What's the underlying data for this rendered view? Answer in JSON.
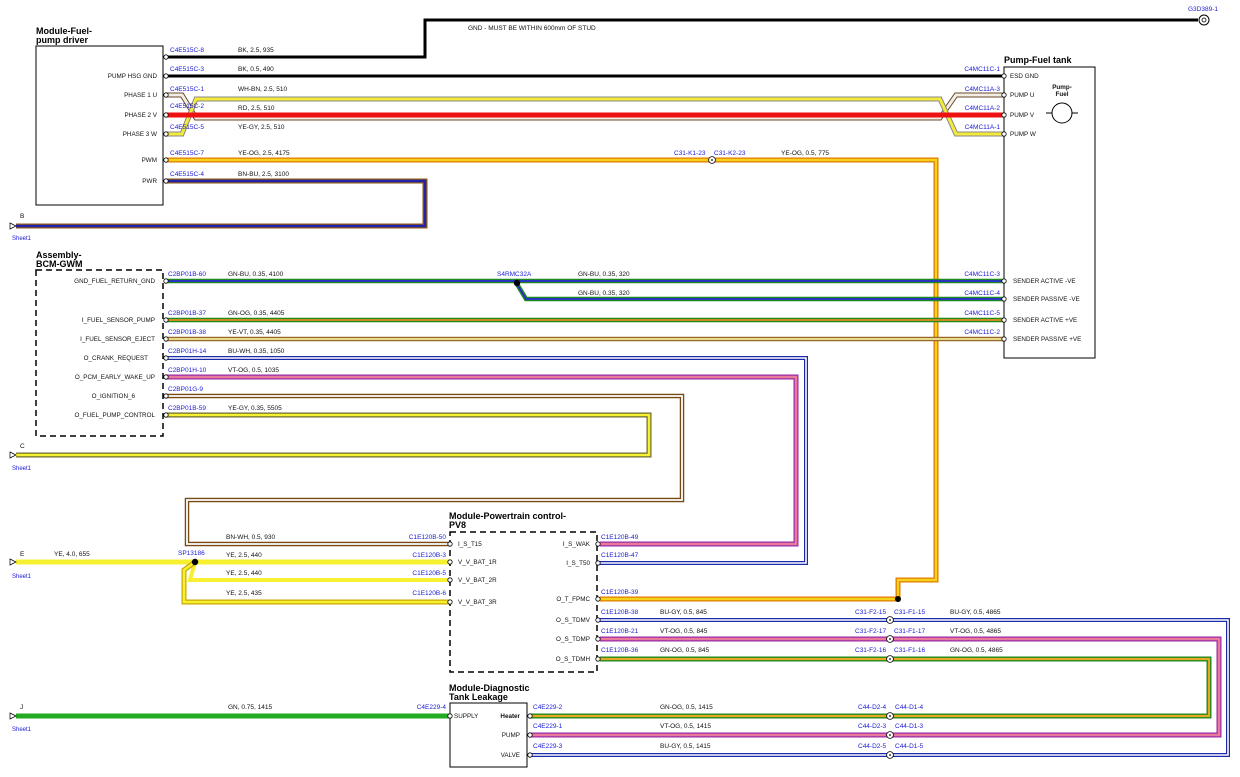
{
  "modules": {
    "fuel_pump_driver": {
      "title_line1": "Module-Fuel-",
      "title_line2": "pump driver",
      "pins": [
        "PUMP HSG GND",
        "PHASE 1 U",
        "PHASE 2 V",
        "PHASE 3 W",
        "PWM",
        "PWR"
      ]
    },
    "pump_fuel_tank": {
      "title": "Pump-Fuel tank",
      "pins": [
        "ESD GND",
        "PUMP U",
        "PUMP V",
        "PUMP W",
        "SENDER ACTIVE -VE",
        "SENDER PASSIVE -VE",
        "SENDER ACTIVE +VE",
        "SENDER PASSIVE +VE"
      ],
      "symbol_line1": "Pump-",
      "symbol_line2": "Fuel"
    },
    "bcm_gwm": {
      "title_line1": "Assembly-",
      "title_line2": "BCM-GWM",
      "pins": [
        "GND_FUEL_RETURN_GND",
        "I_FUEL_SENSOR_PUMP",
        "I_FUEL_SENSOR_EJECT",
        "O_CRANK_REQUEST",
        "O_PCM_EARLY_WAKE_UP",
        "O_IGNITION_6",
        "O_FUEL_PUMP_CONTROL"
      ]
    },
    "pcm": {
      "title_line1": "Module-Powertrain control-",
      "title_line2": "PV8",
      "pins_left": [
        "I_S_T15",
        "V_V_BAT_1R",
        "V_V_BAT_2R",
        "V_V_BAT_3R"
      ],
      "pins_right": [
        "I_S_WAK",
        "I_S_T50",
        "O_T_FPMC",
        "O_S_TDMV",
        "O_S_TDMP",
        "O_S_TDMH"
      ]
    },
    "dtl": {
      "title_line1": "Module-Diagnostic",
      "title_line2": "Tank Leakage",
      "pin_supply": "SUPPLY",
      "pin_heater": "Heater",
      "pin_pump": "PUMP",
      "pin_valve": "VALVE"
    }
  },
  "ground": {
    "id": "G3D389-1",
    "note": "GND - MUST BE WITHIN 600mm OF STUD"
  },
  "sheet_refs": [
    {
      "letter": "B",
      "sheet": "Sheet1"
    },
    {
      "letter": "C",
      "sheet": "Sheet1"
    },
    {
      "letter": "E",
      "sheet": "Sheet1"
    },
    {
      "letter": "J",
      "sheet": "Sheet1"
    }
  ],
  "connectors": {
    "fpd": [
      "C4E515C-8",
      "C4E515C-3",
      "C4E515C-1",
      "C4E515C-2",
      "C4E515C-5",
      "C4E515C-7",
      "C4E515C-4"
    ],
    "tank": [
      "C4MC11C-1",
      "C4MC11A-3",
      "C4MC11A-2",
      "C4MC11A-1",
      "C4MC11C-3",
      "C4MC11C-4",
      "C4MC11C-5",
      "C4MC11C-2"
    ],
    "bcm": [
      "C2BP01B-60",
      "C2BP01B-37",
      "C2BP01B-38",
      "C2BP01H-14",
      "C2BP01H-10",
      "C2BP01G-9",
      "C2BP01B-59"
    ],
    "inline_pwm": [
      "C31-K1-23",
      "C31-K2-23"
    ],
    "splice_bcm": "S4RMC32A",
    "splice_pcm": "SP13186",
    "pcm_left": [
      "C1E120B-50",
      "C1E120B-3",
      "C1E120B-5",
      "C1E120B-6"
    ],
    "pcm_right": [
      "C1E120B-49",
      "C1E120B-47",
      "C1E120B-39",
      "C1E120B-38",
      "C1E120B-21",
      "C1E120B-36"
    ],
    "inline_tdm": [
      [
        "C31-F2-15",
        "C31-F1-15"
      ],
      [
        "C31-F2-17",
        "C31-F1-17"
      ],
      [
        "C31-F2-16",
        "C31-F1-16"
      ]
    ],
    "dtl_supply": "C4E229-4",
    "dtl": [
      "C4E229-2",
      "C4E229-1",
      "C4E229-3"
    ],
    "inline_dtl": [
      [
        "C44-D2-4",
        "C44-D1-4"
      ],
      [
        "C44-D2-3",
        "C44-D1-3"
      ],
      [
        "C44-D2-5",
        "C44-D1-5"
      ]
    ]
  },
  "wires": {
    "gnd_stud": "BK, 2.5, 935",
    "hsg_gnd": "BK, 0.5, 490",
    "phase_u": "WH-BN, 2.5, 510",
    "phase_v": "RD, 2.5, 510",
    "phase_w": "YE-GY, 2.5, 510",
    "pwm_a": "YE-OG, 2.5, 4175",
    "pwm_b": "YE-OG, 0.5, 775",
    "pwr": "BN-BU, 2.5, 3100",
    "ret_a": "GN-BU, 0.35, 4100",
    "ret_b": "GN-BU, 0.35, 320",
    "ret_c": "GN-BU, 0.35, 320",
    "sens_pump": "GN-OG, 0.35, 4405",
    "sens_eject": "YE-VT, 0.35, 4405",
    "crank": "BU-WH, 0.35, 1050",
    "wake": "VT-OG, 0.5, 1035",
    "fpc": "YE-GY, 0.35, 5505",
    "t15": "BN-WH, 0.5, 930",
    "bat_feed": "YE, 4.0, 655",
    "bat1": "YE, 2.5, 440",
    "bat2": "YE, 2.5, 440",
    "bat3": "YE, 2.5, 435",
    "tdmv": "BU-GY, 0.5, 845",
    "tdmp": "VT-OG, 0.5, 845",
    "tdmh": "GN-OG, 0.5, 845",
    "tdmv_b": "BU-GY, 0.5, 4865",
    "tdmp_b": "VT-OG, 0.5, 4865",
    "tdmh_b": "GN-OG, 0.5, 4865",
    "supply": "GN, 0.75, 1415",
    "heater": "GN-OG, 0.5, 1415",
    "pump": "VT-OG, 0.5, 1415",
    "valve": "BU-GY, 0.5, 1415"
  }
}
